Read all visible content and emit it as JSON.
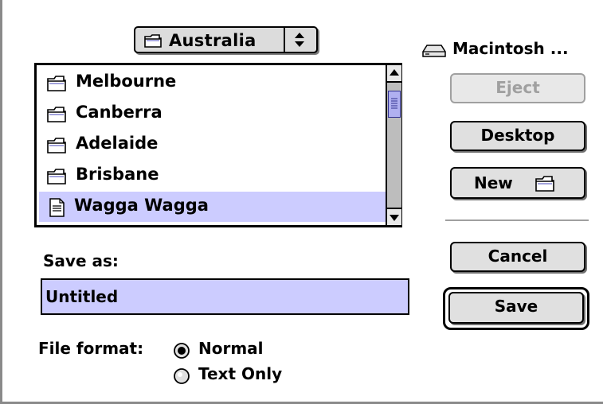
{
  "popup": {
    "label": "Australia",
    "icon": "folder-icon"
  },
  "volume": {
    "label": "Macintosh ...",
    "icon": "hard-disk-icon"
  },
  "files": [
    {
      "name": "Melbourne",
      "icon": "folder-icon"
    },
    {
      "name": "Canberra",
      "icon": "folder-icon"
    },
    {
      "name": "Adelaide",
      "icon": "folder-icon"
    },
    {
      "name": "Brisbane",
      "icon": "folder-icon"
    },
    {
      "name": "Wagga Wagga",
      "icon": "document-icon",
      "selected": true
    }
  ],
  "buttons": {
    "eject": "Eject",
    "desktop": "Desktop",
    "new": "New",
    "cancel": "Cancel",
    "save": "Save"
  },
  "save_as": {
    "label": "Save as:",
    "value": "Untitled"
  },
  "file_format": {
    "label": "File format:",
    "options": [
      {
        "label": "Normal",
        "selected": true
      },
      {
        "label": "Text Only",
        "selected": false
      }
    ]
  },
  "colors": {
    "selection": "#ccccff",
    "button_face": "#e0e0e0",
    "disabled_text": "#a0a0a0"
  }
}
